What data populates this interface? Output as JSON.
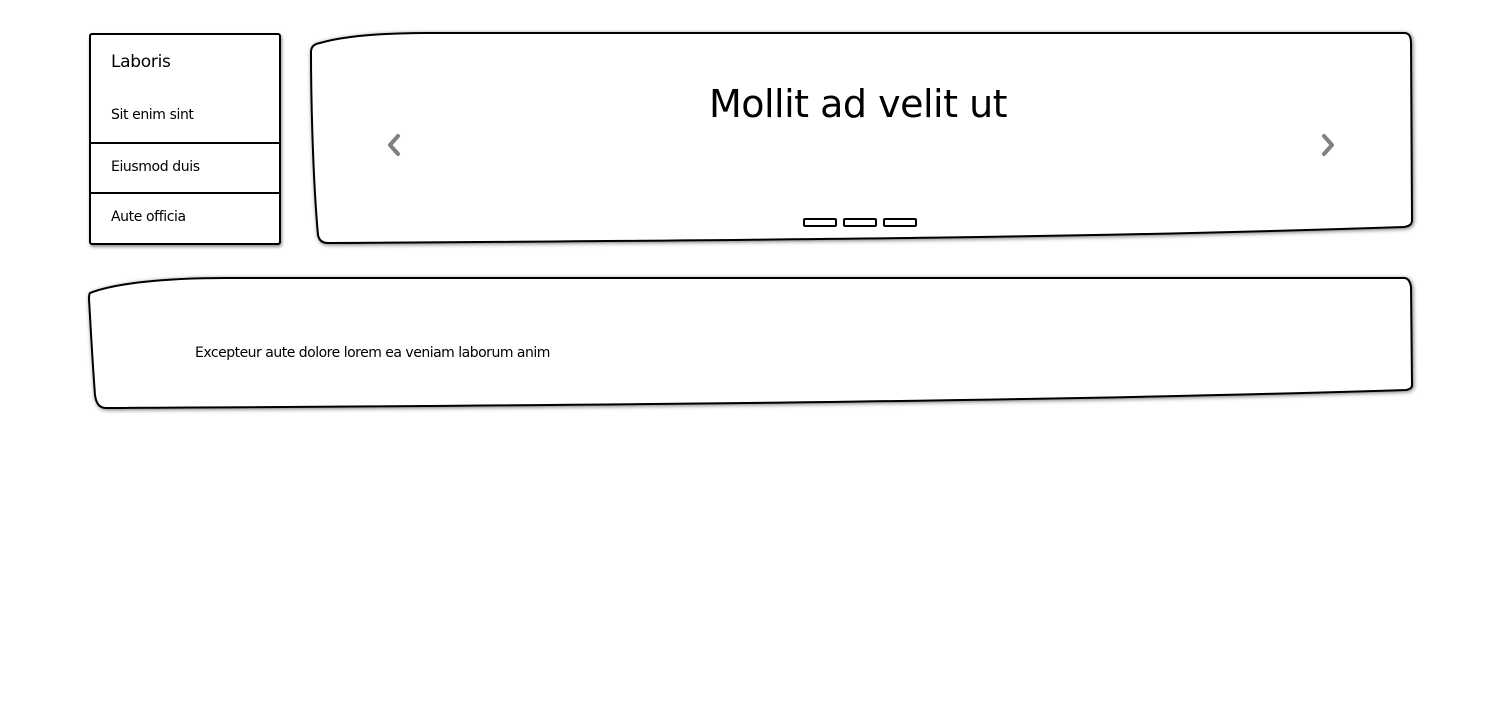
{
  "sidebar": {
    "title": "Laboris",
    "items": [
      {
        "label": "Sit enim sint"
      },
      {
        "label": "Eiusmod duis"
      },
      {
        "label": "Aute officia"
      }
    ]
  },
  "carousel": {
    "slide_title": "Mollit ad velit ut",
    "prev_icon": "chevron-left-icon",
    "next_icon": "chevron-right-icon",
    "indicator_count": 3
  },
  "panel": {
    "text": "Excepteur aute dolore lorem ea veniam laborum anim"
  },
  "colors": {
    "border": "#000000",
    "arrow": "#808080",
    "background": "#ffffff"
  }
}
